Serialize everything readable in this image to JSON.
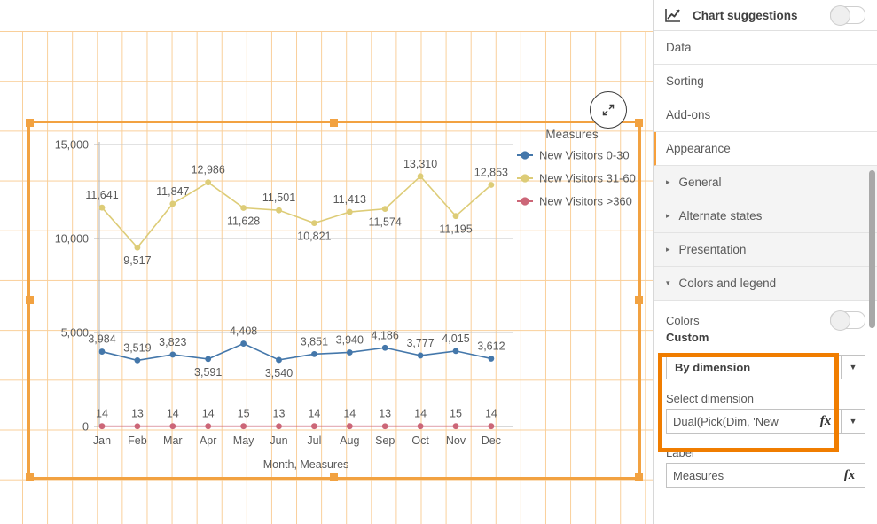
{
  "panel": {
    "suggestions": {
      "label": "Chart suggestions",
      "icon": "line-chart-icon",
      "toggle_state": "off"
    },
    "accordion": [
      {
        "label": "Data",
        "active": false
      },
      {
        "label": "Sorting",
        "active": false
      },
      {
        "label": "Add-ons",
        "active": false
      },
      {
        "label": "Appearance",
        "active": true
      }
    ],
    "subsections": [
      {
        "label": "General",
        "expanded": false,
        "caret": "▸"
      },
      {
        "label": "Alternate states",
        "expanded": false,
        "caret": "▸"
      },
      {
        "label": "Presentation",
        "expanded": false,
        "caret": "▸"
      },
      {
        "label": "Colors and legend",
        "expanded": true,
        "caret": "▾"
      }
    ],
    "colors_label": "Colors",
    "colors_toggle_state": "off",
    "custom_label": "Custom",
    "color_mode": {
      "value": "By dimension"
    },
    "select_dimension": {
      "label": "Select dimension",
      "value": "Dual(Pick(Dim, 'New",
      "fx": "fx"
    },
    "label_field": {
      "label": "Label",
      "value": "Measures",
      "fx": "fx"
    },
    "highlight_color": "#f07d00",
    "accent_color": "#f7a03c"
  },
  "chart": {
    "expand_icon": "expand-icon",
    "legend_title": "Measures",
    "x_axis_title": "Month, Measures"
  },
  "chart_data": {
    "type": "line",
    "title": "",
    "xlabel": "Month, Measures",
    "ylabel": "",
    "categories": [
      "Jan",
      "Feb",
      "Mar",
      "Apr",
      "May",
      "Jun",
      "Jul",
      "Aug",
      "Sep",
      "Oct",
      "Nov",
      "Dec"
    ],
    "y_ticks": [
      "0",
      "5,000",
      "10,000",
      "15,000"
    ],
    "y_tick_values": [
      0,
      5000,
      10000,
      15000
    ],
    "ylim": [
      0,
      15000
    ],
    "grid": true,
    "legend_position": "right",
    "legend_entries": [
      "New Visitors 0-30",
      "New Visitors 31-60",
      "New Visitors >360"
    ],
    "series": [
      {
        "name": "New Visitors 0-30",
        "color": "#4477aa",
        "values": [
          3984,
          3519,
          3823,
          3591,
          4408,
          3540,
          3851,
          3940,
          4186,
          3777,
          4015,
          3612
        ],
        "labels": [
          "3,984",
          "3,519",
          "3,823",
          "3,591",
          "4,408",
          "3,540",
          "3,851",
          "3,940",
          "4,186",
          "3,777",
          "4,015",
          "3,612"
        ],
        "label_positions": [
          "above",
          "above",
          "above",
          "below",
          "above",
          "below",
          "above",
          "above",
          "above",
          "above",
          "above",
          "above"
        ]
      },
      {
        "name": "New Visitors 31-60",
        "color": "#ddcc77",
        "values": [
          11641,
          9517,
          11847,
          12986,
          11628,
          11501,
          10821,
          11413,
          11574,
          13310,
          11195,
          12853
        ],
        "labels": [
          "11,641",
          "9,517",
          "11,847",
          "12,986",
          "11,628",
          "11,501",
          "10,821",
          "11,413",
          "11,574",
          "13,310",
          "11,195",
          "12,853"
        ],
        "label_positions": [
          "above",
          "below",
          "above",
          "above",
          "below",
          "above",
          "below",
          "above",
          "below",
          "above",
          "below",
          "above"
        ]
      },
      {
        "name": "New Visitors >360",
        "color": "#cc6677",
        "values": [
          14,
          13,
          14,
          14,
          15,
          13,
          14,
          14,
          13,
          14,
          15,
          14
        ],
        "labels": [
          "14",
          "13",
          "14",
          "14",
          "15",
          "13",
          "14",
          "14",
          "13",
          "14",
          "15",
          "14"
        ],
        "label_positions": [
          "above",
          "above",
          "above",
          "above",
          "above",
          "above",
          "above",
          "above",
          "above",
          "above",
          "above",
          "above"
        ]
      }
    ]
  }
}
